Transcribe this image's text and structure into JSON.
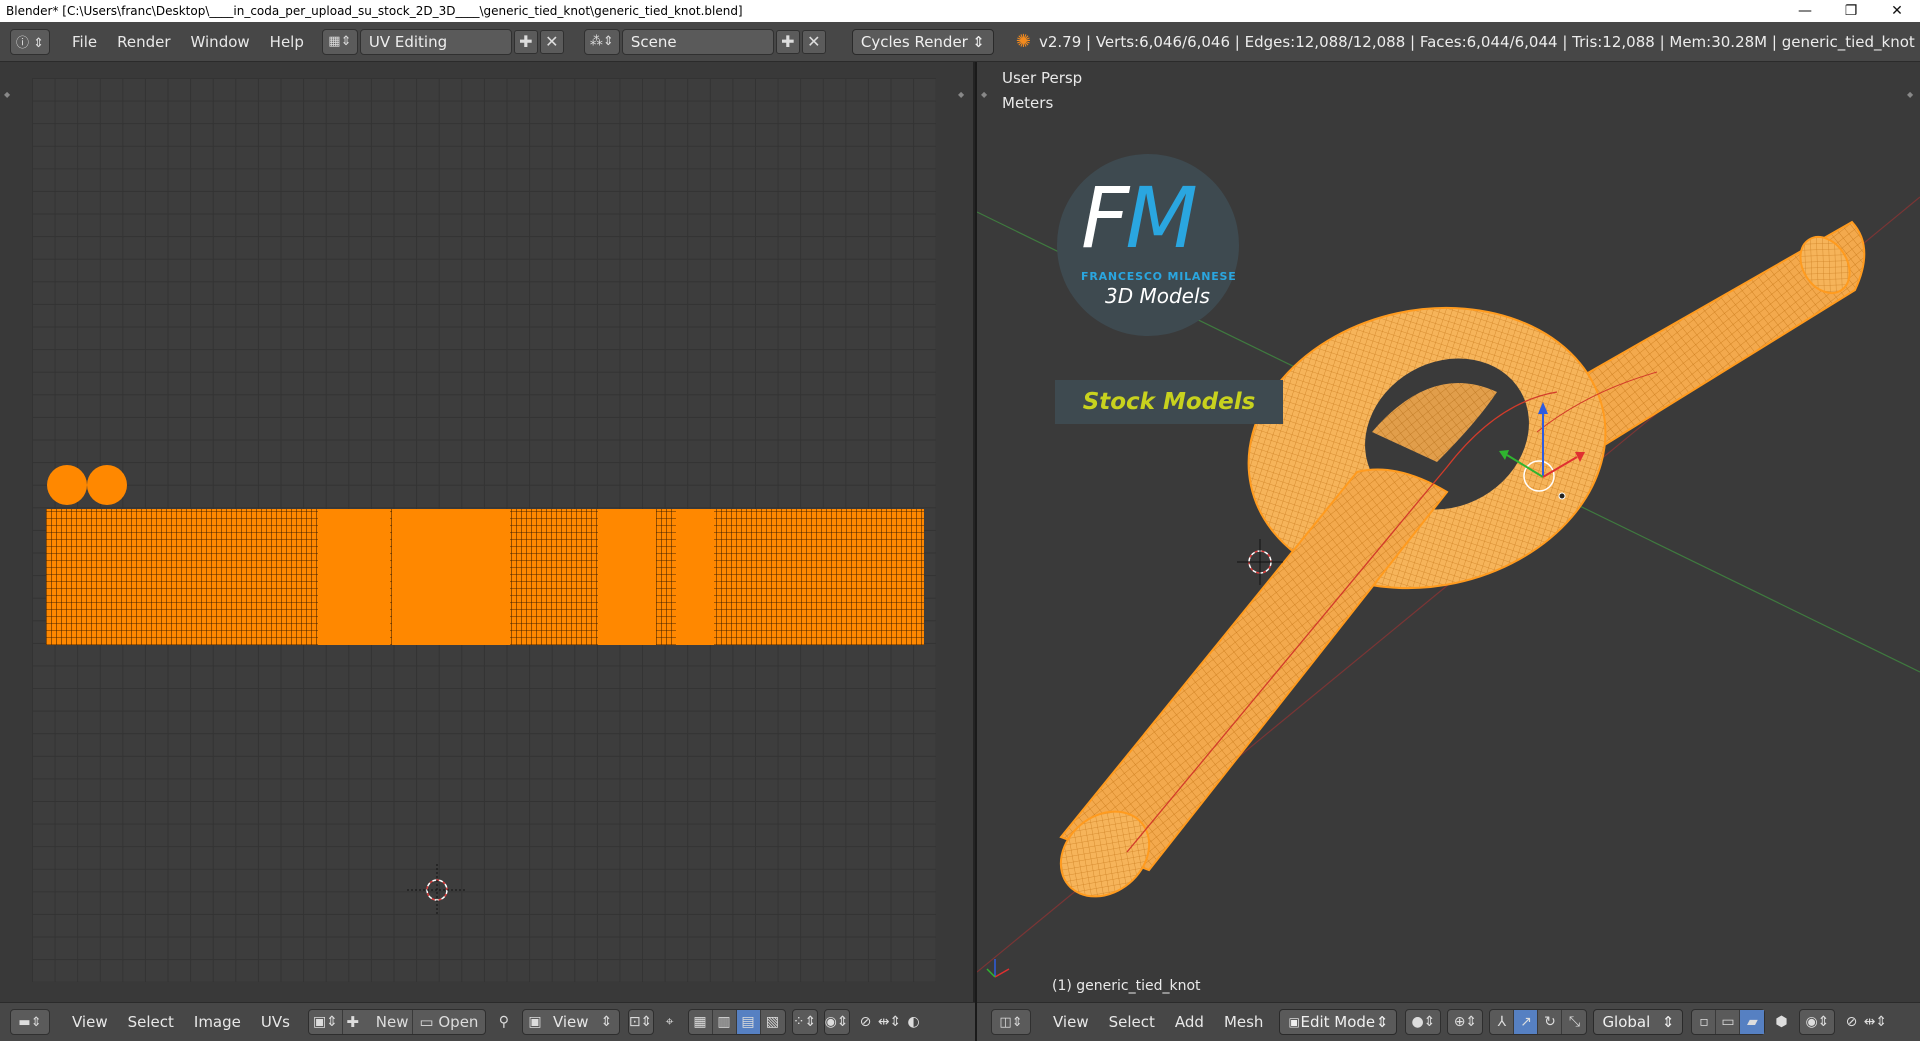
{
  "window": {
    "title": "Blender* [C:\\Users\\franc\\Desktop\\____in_coda_per_upload_su_stock_2D_3D____\\generic_tied_knot\\generic_tied_knot.blend]",
    "minimize": "—",
    "restore": "❐",
    "close": "✕"
  },
  "infobar": {
    "menus": [
      "File",
      "Render",
      "Window",
      "Help"
    ],
    "screen_layout": "UV Editing",
    "scene": "Scene",
    "render_engine": "Cycles Render",
    "stats": "v2.79 | Verts:6,046/6,046 | Edges:12,088/12,088 | Faces:6,044/6,044 | Tris:12,088 | Mem:30.28M | generic_tied_knot"
  },
  "uv_editor": {
    "menus": [
      "View",
      "Select",
      "Image",
      "UVs"
    ],
    "new_label": "New",
    "open_label": "Open",
    "view_label": "View"
  },
  "viewport": {
    "persp_label": "User Persp",
    "units_label": "Meters",
    "object_label": "(1) generic_tied_knot",
    "menus": [
      "View",
      "Select",
      "Add",
      "Mesh"
    ],
    "mode": "Edit Mode",
    "orientation": "Global"
  },
  "watermark": {
    "logo_text": "FM",
    "author": "FRANCESCO MILANESE",
    "tagline": "3D Models",
    "banner": "Stock Models"
  },
  "colors": {
    "accent_orange": "#ff8800",
    "select_blue": "#5680c2",
    "logo_blue": "#2aa6e0",
    "banner_yellow": "#c8d21e"
  }
}
